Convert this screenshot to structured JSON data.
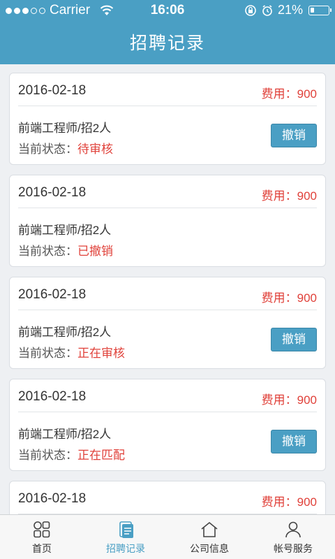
{
  "status_bar": {
    "carrier": "Carrier",
    "time": "16:06",
    "battery": "21%",
    "battery_level": 0.21
  },
  "header": {
    "title": "招聘记录"
  },
  "records": [
    {
      "date": "2016-02-18",
      "fee": "费用：900",
      "job": "前端工程师/招2人",
      "state_label": "当前状态：",
      "state": "待审核",
      "cancel": "撤销",
      "has_cancel": true
    },
    {
      "date": "2016-02-18",
      "fee": "费用：900",
      "job": "前端工程师/招2人",
      "state_label": "当前状态：",
      "state": "已撤销",
      "cancel": "",
      "has_cancel": false
    },
    {
      "date": "2016-02-18",
      "fee": "费用：900",
      "job": "前端工程师/招2人",
      "state_label": "当前状态：",
      "state": "正在审核",
      "cancel": "撤销",
      "has_cancel": true
    },
    {
      "date": "2016-02-18",
      "fee": "费用：900",
      "job": "前端工程师/招2人",
      "state_label": "当前状态：",
      "state": "正在匹配",
      "cancel": "撤销",
      "has_cancel": true
    },
    {
      "date": "2016-02-18",
      "fee": "费用：900",
      "job": "",
      "state_label": "",
      "state": "",
      "cancel": "",
      "has_cancel": false
    }
  ],
  "tabbar": {
    "tabs": [
      {
        "label": "首页",
        "icon": "home-grid-icon",
        "active": false
      },
      {
        "label": "招聘记录",
        "icon": "document-icon",
        "active": true
      },
      {
        "label": "公司信息",
        "icon": "house-icon",
        "active": false
      },
      {
        "label": "帐号服务",
        "icon": "user-icon",
        "active": false
      }
    ]
  },
  "colors": {
    "accent": "#4a9fc4",
    "alert": "#e0413a"
  }
}
